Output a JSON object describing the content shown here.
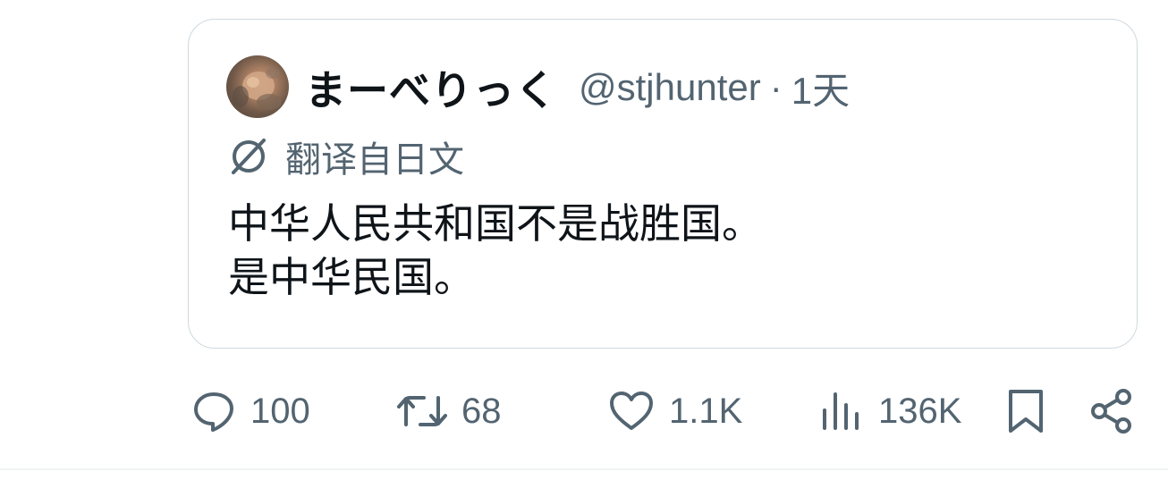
{
  "quoted_tweet": {
    "author": {
      "display_name": "まーべりっく",
      "handle": "@stjhunter",
      "separator": "·",
      "time": "1天"
    },
    "translation_label": "翻译自日文",
    "text_lines": [
      "中华人民共和国不是战胜国。",
      "是中华民国。"
    ]
  },
  "actions": {
    "replies": "100",
    "reposts": "68",
    "likes": "1.1K",
    "views": "136K"
  },
  "icons": {
    "reply": "reply-icon",
    "repost": "repost-icon",
    "like": "like-icon",
    "views": "views-icon",
    "bookmark": "bookmark-icon",
    "share": "share-icon",
    "translate": "translate-icon"
  },
  "colors": {
    "text_primary": "#0f1419",
    "text_secondary": "#536471",
    "border": "#cfd9de"
  }
}
